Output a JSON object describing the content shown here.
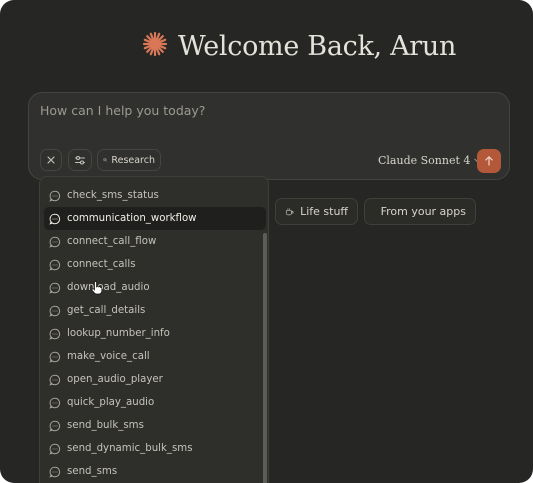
{
  "colors": {
    "accent": "#b4583a",
    "background": "#262624",
    "surface": "#30302e",
    "logo": "#d97757"
  },
  "greeting": {
    "icon": "claude-spark-icon",
    "text": "Welcome Back, Arun"
  },
  "composer": {
    "placeholder": "How can I help you today?",
    "value": "",
    "research_label": "Research",
    "model_label": "Claude Sonnet 4"
  },
  "chips": [
    {
      "label": "Life stuff",
      "icon": "coffee-cup-icon"
    },
    {
      "label": "From your apps",
      "icon": "grid-icon"
    }
  ],
  "tools_dropdown": {
    "items": [
      {
        "label": "check_sms_status"
      },
      {
        "label": "communication_workflow",
        "active": true
      },
      {
        "label": "connect_call_flow"
      },
      {
        "label": "connect_calls"
      },
      {
        "label": "download_audio"
      },
      {
        "label": "get_call_details"
      },
      {
        "label": "lookup_number_info"
      },
      {
        "label": "make_voice_call"
      },
      {
        "label": "open_audio_player"
      },
      {
        "label": "quick_play_audio"
      },
      {
        "label": "send_bulk_sms"
      },
      {
        "label": "send_dynamic_bulk_sms"
      },
      {
        "label": "send_sms"
      }
    ]
  }
}
